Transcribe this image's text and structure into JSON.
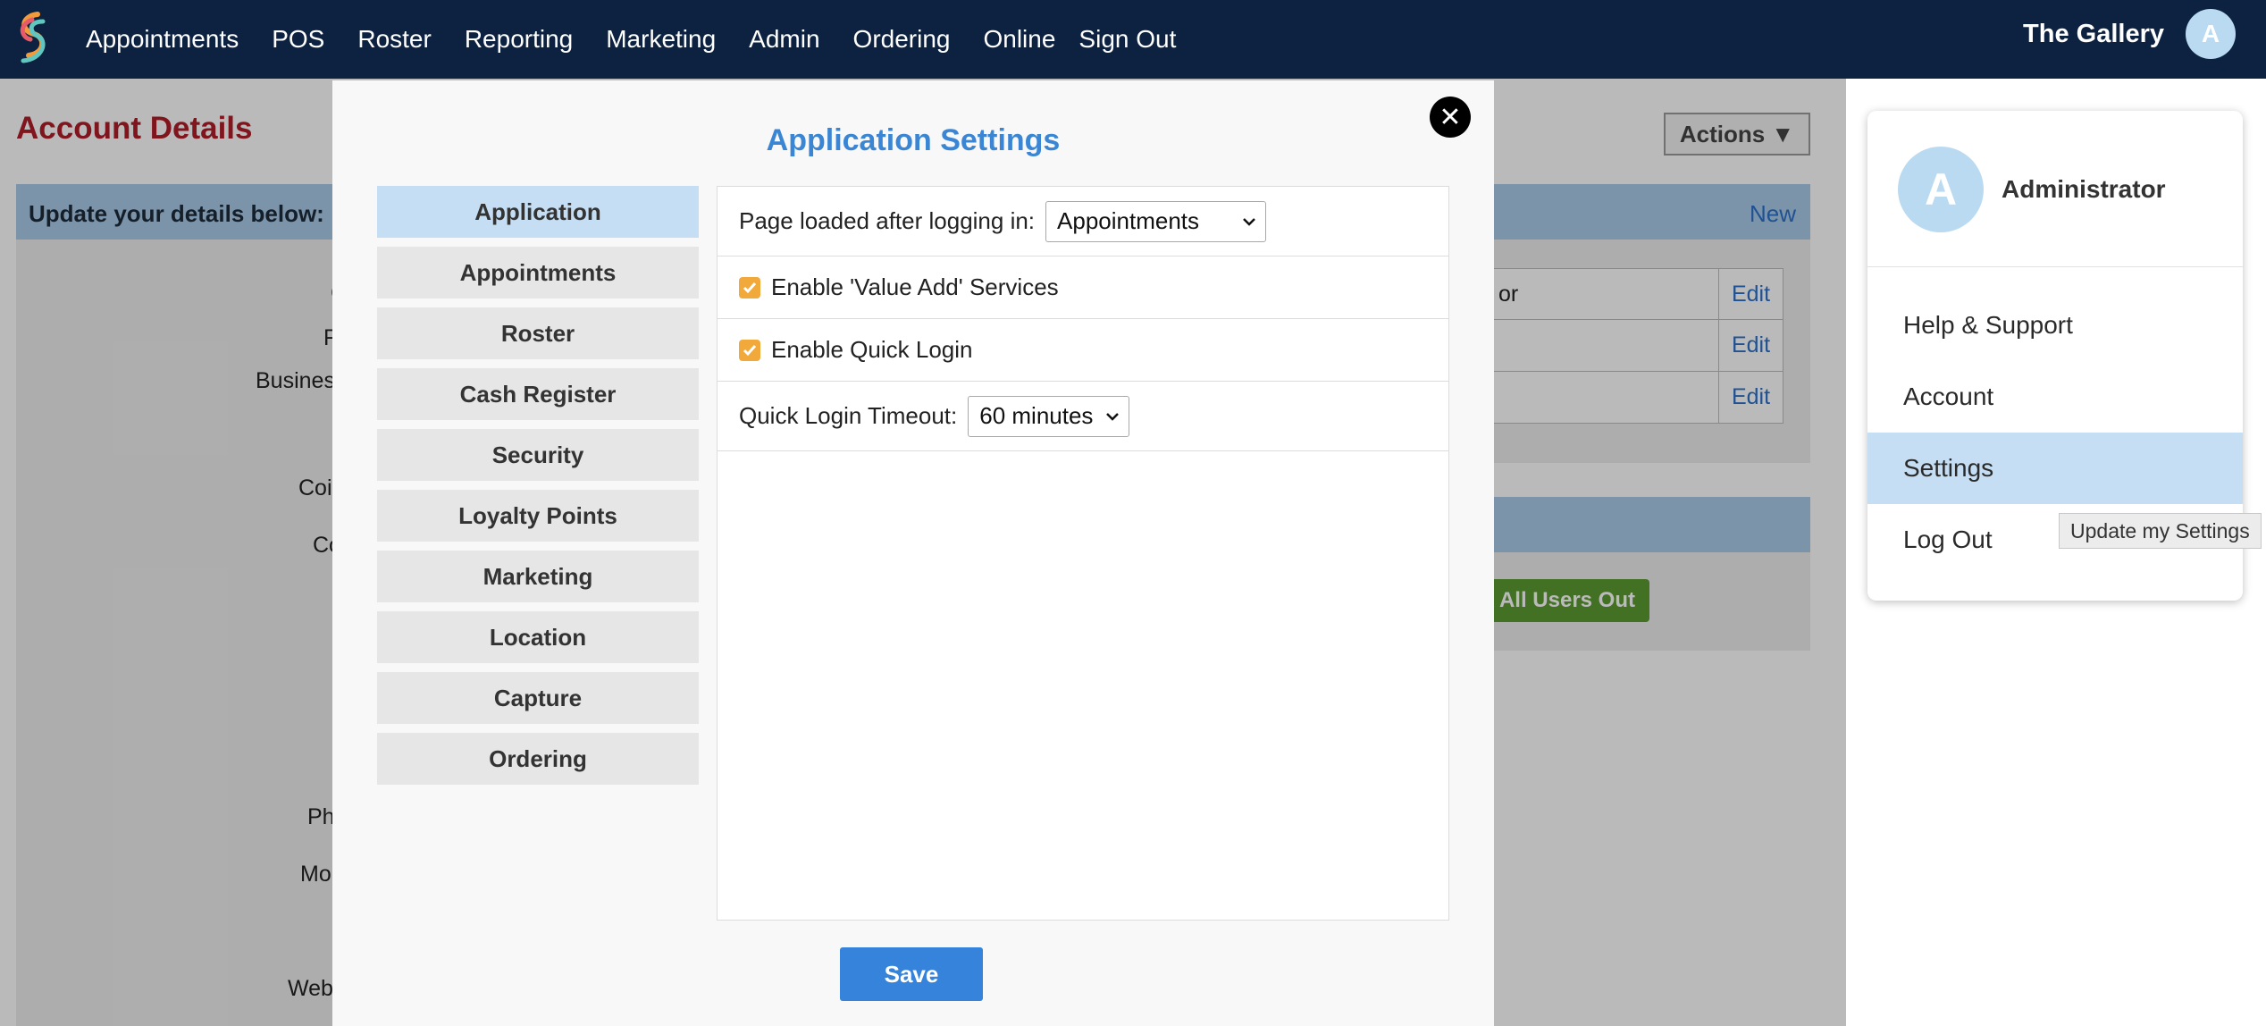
{
  "nav": {
    "items": [
      "Appointments",
      "POS",
      "Roster",
      "Reporting",
      "Marketing",
      "Admin",
      "Ordering",
      "Online",
      "Sign Out"
    ],
    "brand": "The Gallery",
    "avatar_letter": "A"
  },
  "background": {
    "page_title": "Account Details",
    "actions_label": "Actions ▼",
    "band_text": "Update your details below:",
    "band_new": "New",
    "table_rows": [
      {
        "text": "or",
        "action": "Edit"
      },
      {
        "text": "",
        "action": "Edit"
      },
      {
        "text": "",
        "action": "Edit"
      }
    ],
    "logout_all_label": "k All Users Out",
    "side_labels": [
      "C",
      "F",
      "Busines",
      "Coi",
      "Co",
      "Ph",
      "Mo",
      "Web"
    ]
  },
  "modal": {
    "title": "Application Settings",
    "tabs": [
      "Application",
      "Appointments",
      "Roster",
      "Cash Register",
      "Security",
      "Loyalty Points",
      "Marketing",
      "Location",
      "Capture",
      "Ordering"
    ],
    "active_tab": "Application",
    "page_loaded_label": "Page loaded after logging in:",
    "page_loaded_value": "Appointments",
    "value_add_label": "Enable 'Value Add' Services",
    "value_add_checked": true,
    "quick_login_label": "Enable Quick Login",
    "quick_login_checked": true,
    "timeout_label": "Quick Login Timeout:",
    "timeout_value": "60 minutes",
    "save_label": "Save"
  },
  "dropdown": {
    "avatar_letter": "A",
    "user": "Administrator",
    "items": [
      "Help & Support",
      "Account",
      "Settings",
      "Log Out"
    ],
    "active_item": "Settings",
    "tooltip": "Update my Settings"
  },
  "colors": {
    "nav_bg": "#0d2240",
    "accent_blue": "#3683db",
    "title_red": "#b01e28",
    "checkbox_orange": "#f2a93b",
    "active_tab": "#c5def3",
    "logout_green": "#5d9b32"
  }
}
